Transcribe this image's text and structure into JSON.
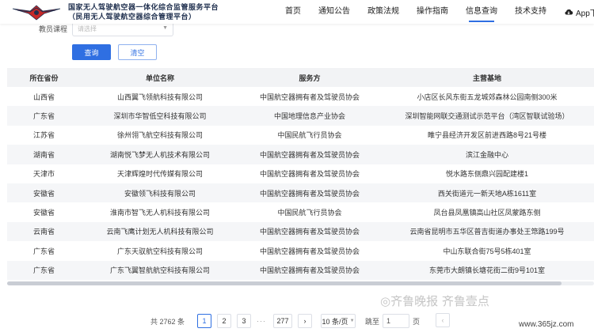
{
  "header": {
    "title_line1": "国家无人驾驶航空器一体化综合监管服务平台",
    "title_line2": "（民用无人驾驶航空器综合管理平台）",
    "nav": [
      "首页",
      "通知公告",
      "政策法规",
      "操作指南",
      "信息查询",
      "技术支持"
    ],
    "active_nav": "信息查询",
    "app_download": "App下载"
  },
  "filter": {
    "label": "教员课程",
    "placeholder": "请选择",
    "query_button": "查询",
    "clear_button": "清空"
  },
  "table": {
    "columns": [
      "所在省份",
      "单位名称",
      "服务方",
      "主营基地"
    ],
    "rows": [
      [
        "山西省",
        "山西翼飞领航科技有限公司",
        "中国航空器拥有者及驾驶员协会",
        "小店区长风东街五龙城郊森林公园南侧300米"
      ],
      [
        "广东省",
        "深圳市华智低空科技有限公司",
        "中国地理信息产业协会",
        "深圳智能网联交通测试示范平台（湾区智联试验场）"
      ],
      [
        "江苏省",
        "徐州翎飞航空科技有限公司",
        "中国民航飞行员协会",
        "睢宁县经济开发区前进西路8号21号楼"
      ],
      [
        "湖南省",
        "湖南悦飞梦无人机技术有限公司",
        "中国航空器拥有者及驾驶员协会",
        "滨江金融中心"
      ],
      [
        "天津市",
        "天津辉煌时代传媒有限公司",
        "中国航空器拥有者及驾驶员协会",
        "悦水路东侧鼎兴园配建楼1"
      ],
      [
        "安徽省",
        "安徽领飞科技有限公司",
        "中国航空器拥有者及驾驶员协会",
        "西关街道元一新天地A栋1611室"
      ],
      [
        "安徽省",
        "淮南市智飞无人机科技有限公司",
        "中国民航飞行员协会",
        "凤台县凤凰镇高山社区凤蒙路东侧"
      ],
      [
        "云南省",
        "云南飞鹰计划无人机科技有限公司",
        "中国航空器拥有者及驾驶员协会",
        "云南省昆明市五华区普吉街道办事处王筇路199号"
      ],
      [
        "广东省",
        "广东天驭航空科技有限公司",
        "中国航空器拥有者及驾驶员协会",
        "中山东联合街75号5栋401室"
      ],
      [
        "广东省",
        "广东飞翼智航航空科技有限公司",
        "中国航空器拥有者及驾驶员协会",
        "东莞市大朗镇长塘花街二街9号101室"
      ]
    ]
  },
  "pagination": {
    "total": "共 2762 条",
    "pages": [
      "1",
      "2",
      "3"
    ],
    "ellipsis": "···",
    "last_page": "277",
    "prev": "‹",
    "next": "›",
    "page_size": "10 条/页",
    "jump_label": "跳至",
    "jump_value": "1",
    "page_suffix": "页"
  },
  "watermark": {
    "text": "◎齐鲁晚报 齐鲁壹点",
    "url": "www.365jz.com"
  },
  "colors": {
    "accent": "#2f6fe2",
    "header_bg": "#f2f3f5"
  }
}
